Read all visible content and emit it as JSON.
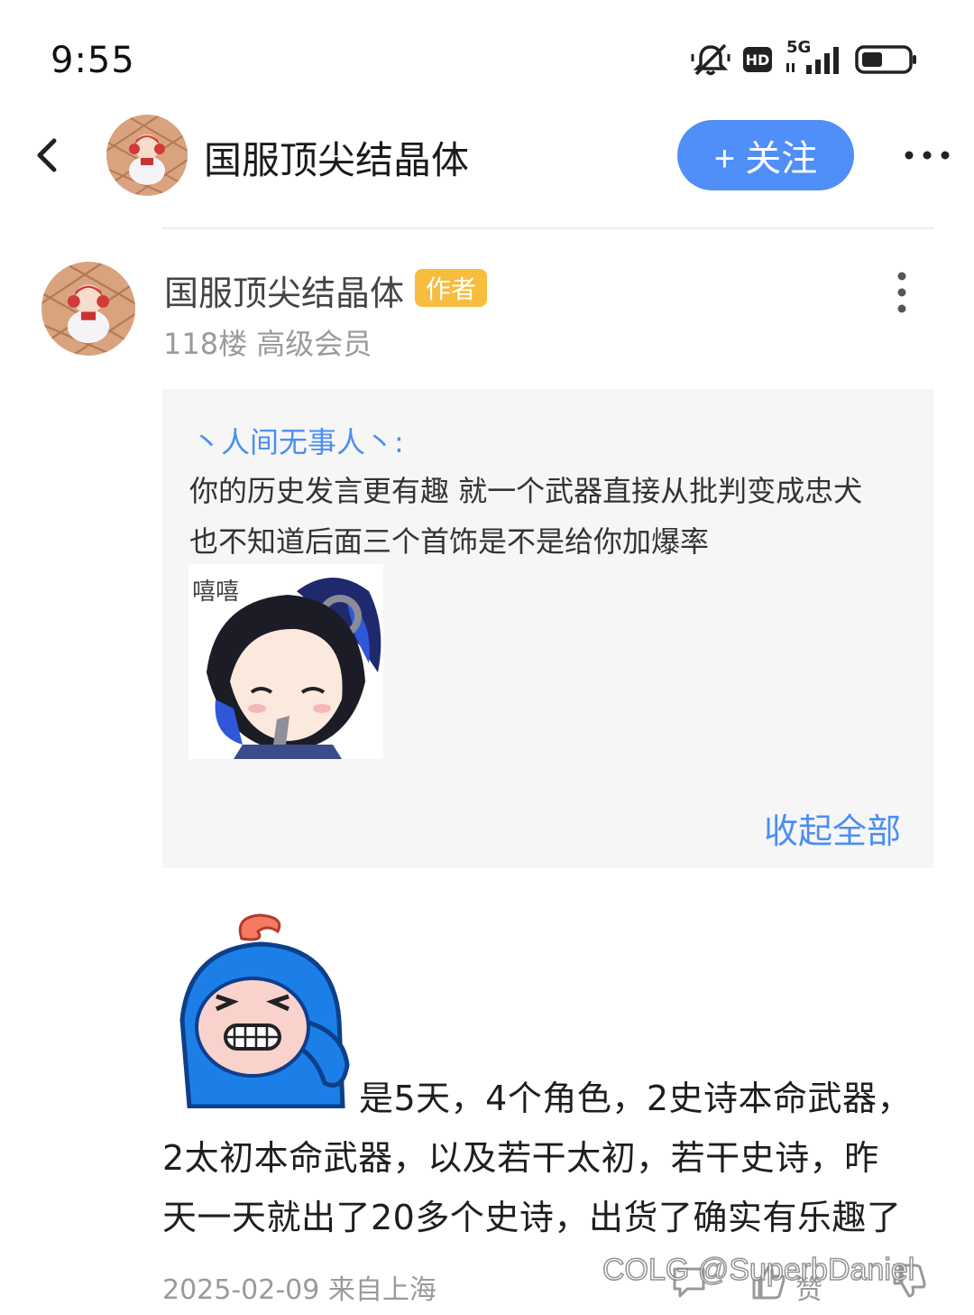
{
  "status_bar": {
    "time": "9:55",
    "icons": [
      "mute-bell-icon",
      "hd-icon",
      "5g-signal-icon",
      "battery-icon"
    ],
    "hd_label": "HD",
    "network_label": "5G"
  },
  "header": {
    "back_icon": "chevron-left-icon",
    "title": "国服顶尖结晶体",
    "follow_label": "+ 关注",
    "more_icon": "more-horizontal-icon",
    "accent_color": "#4f8ff7"
  },
  "post": {
    "author": "国服顶尖结晶体",
    "author_badge": "作者",
    "floor_meta": "118楼 高级会员",
    "more_icon": "more-vertical-icon",
    "quote": {
      "user": "丶人间无事人丶:",
      "lines": [
        "你的历史发言更有趣 就一个武器直接从批判变成忠犬",
        "也不知道后面三个首饰是不是给你加爆率"
      ],
      "sticker_caption": "嘻嘻",
      "collapse_label": "收起全部"
    },
    "body_lines": [
      "是5天，4个角色，2史诗本命武器，",
      "2太初本命武器，以及若干太初，若干史诗，昨",
      "天一天就出了20多个史诗，出货了确实有乐趣了"
    ],
    "footer": {
      "date_location": "2025-02-09 来自上海",
      "reply_icon": "comment-icon",
      "like_icon": "thumbs-up-icon",
      "like_label": "赞",
      "dislike_icon": "thumbs-down-icon"
    }
  },
  "watermark": "COLG @SuperbDaniel"
}
